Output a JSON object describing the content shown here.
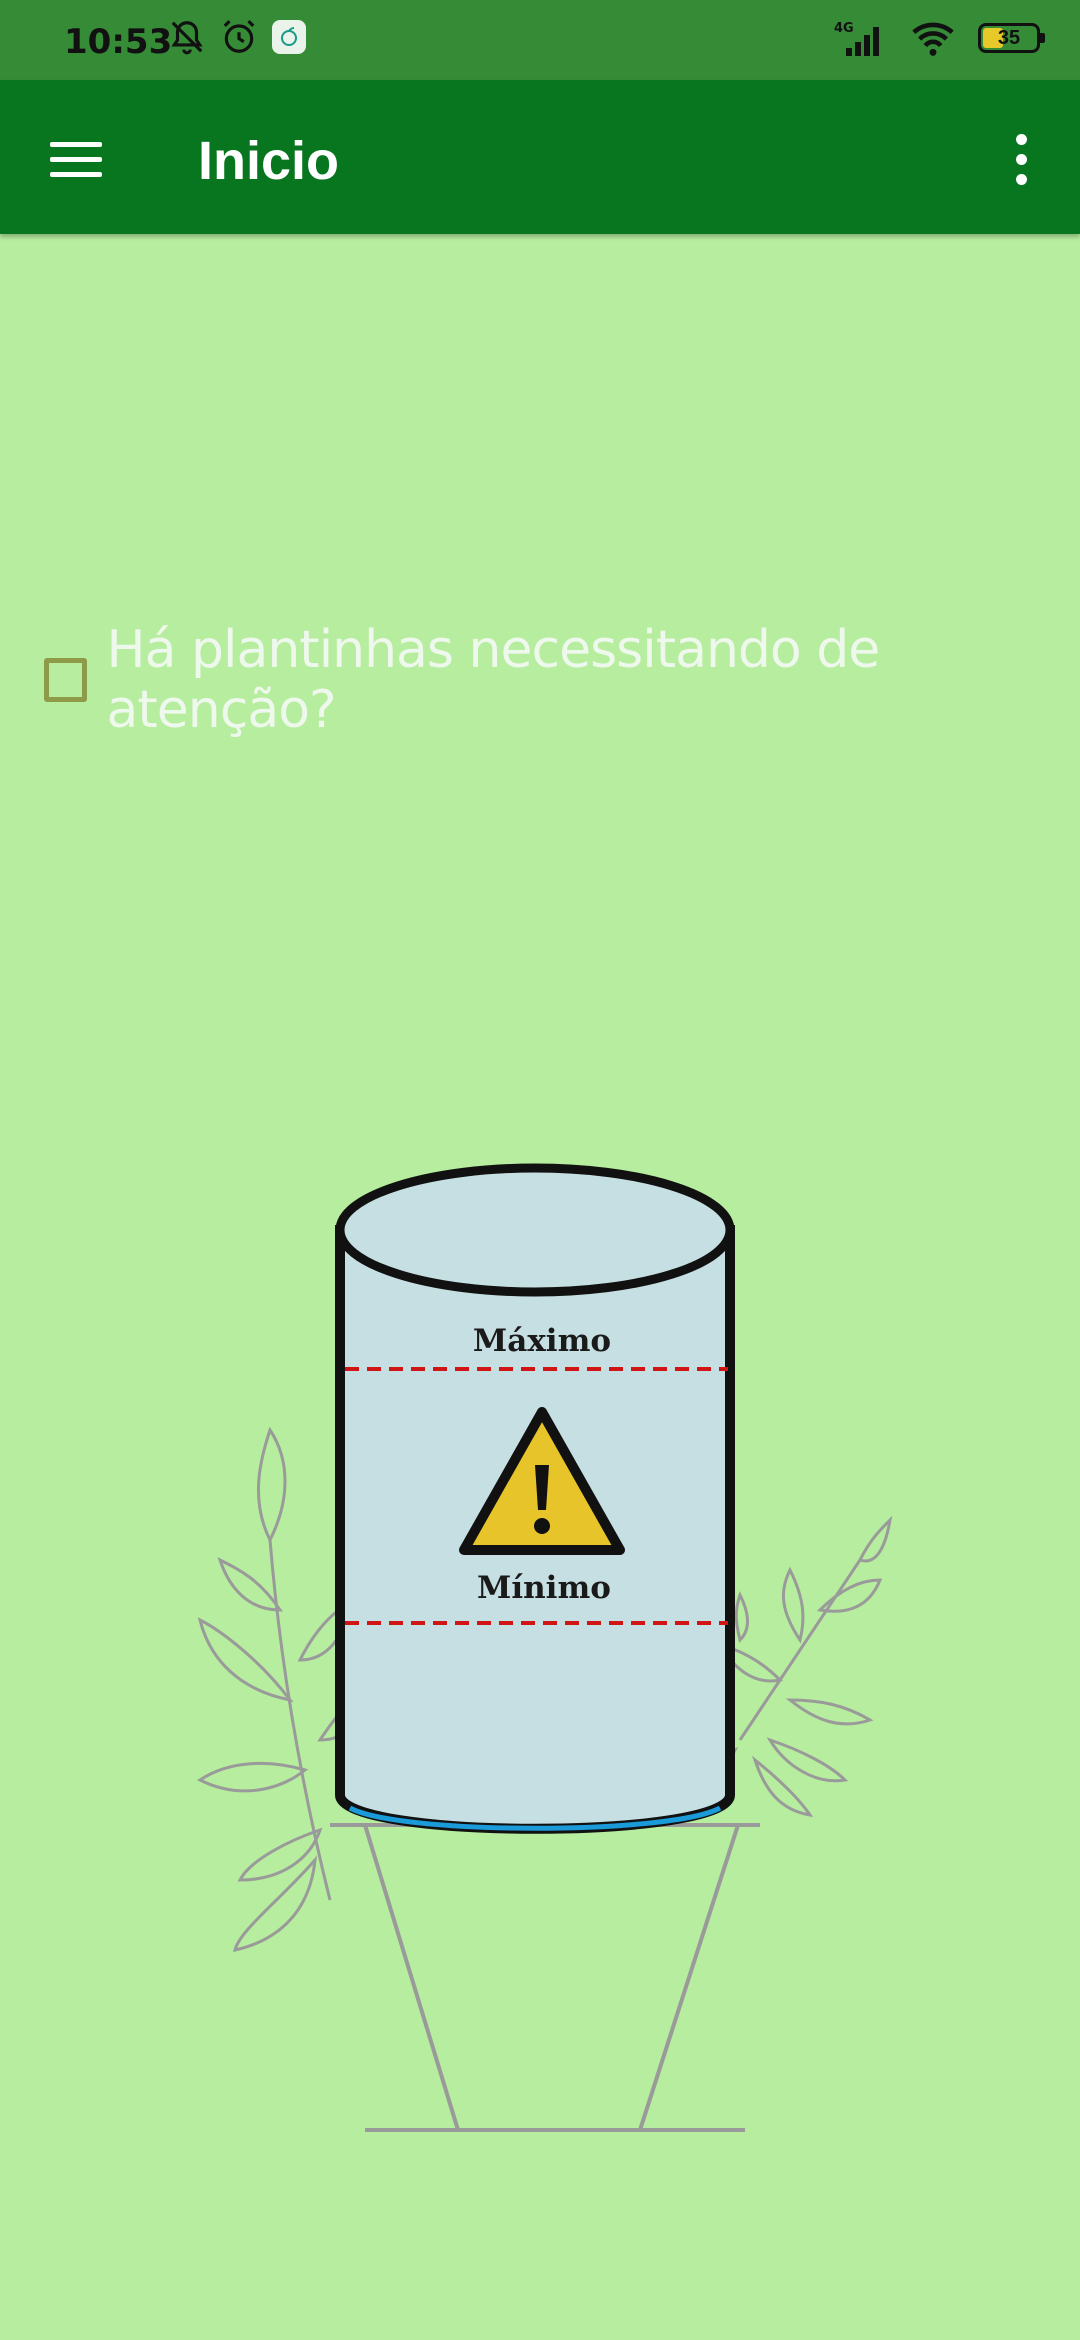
{
  "status_bar": {
    "time": "10:53",
    "battery_level": "35",
    "battery_fraction": 0.35,
    "icons": [
      "mute-bell-icon",
      "alarm-icon",
      "app-notification-icon",
      "signal-4g-icon",
      "wifi-icon",
      "battery-icon"
    ]
  },
  "app_bar": {
    "title": "Inicio",
    "menu_icon": "hamburger-menu-icon",
    "overflow_icon": "more-vertical-icon"
  },
  "main": {
    "checkbox_label": "Há plantinhas necessitando de atenção?",
    "checkbox_checked": false
  },
  "tank": {
    "max_label": "Máximo",
    "min_label": "Mínimo",
    "warning_icon": "warning-triangle-icon",
    "colors": {
      "water": "#c6dfe2",
      "outline": "#111111",
      "level_line": "#d01515",
      "warning": "#e7c52a",
      "stand": "#9a9a9a"
    }
  },
  "colors": {
    "background": "#b6ed9e",
    "status_bar": "#368b37",
    "app_bar": "#08761f"
  }
}
